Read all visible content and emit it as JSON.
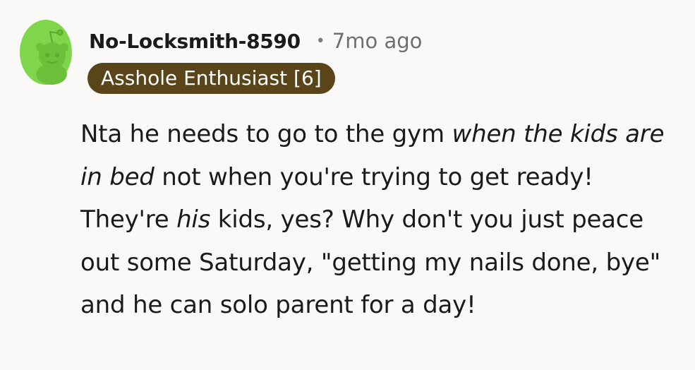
{
  "comment": {
    "author": "No-Locksmith-8590",
    "separator": "•",
    "timestamp": "7mo ago",
    "flair": "Asshole Enthusiast [6]",
    "avatar_icon": "snoo-avatar-icon",
    "avatar_color": "#7fd64b",
    "flair_color": "#5a4419",
    "body": {
      "seg1": "Nta he needs to go to the gym ",
      "seg2_italic": "when the kids are in bed",
      "seg3": " not when you're trying to get ready! They're ",
      "seg4_italic": "his",
      "seg5": " kids, yes? Why don't you just peace out some Saturday, \"getting my nails done, bye\" and he can solo parent for a day!"
    }
  }
}
